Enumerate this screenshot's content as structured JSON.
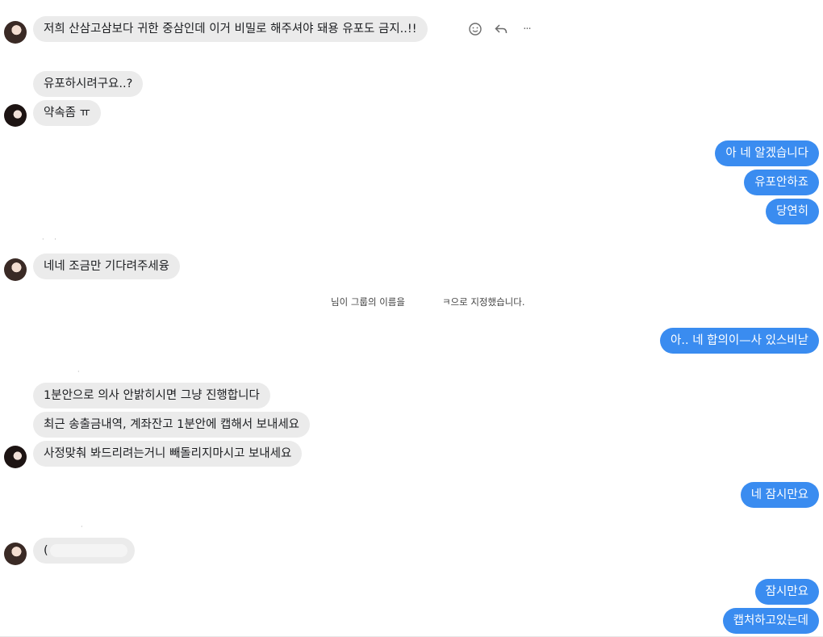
{
  "messages": {
    "m1": "저희 산삼고삼보다 귀한 중삼인데 이거 비밀로 해주셔야 돼용 유포도 금지..!!",
    "m2": "유포하시려구요..?",
    "m3": "약속좀 ㅠ",
    "m4": "아 네 알겠습니다",
    "m5": "유포안하죠",
    "m6": "당연히",
    "m7": "네네 조금만 기다려주세융",
    "m8": "아.. 네 합의이—사 있스비낟",
    "m9": "1분안으로 의사 안밝히시면 그냥 진행합니다",
    "m10": "최근 송출금내역, 계좌잔고 1분안에 캡해서 보내세요",
    "m11": "사정맞춰 봐드리려는거니 빼돌리지마시고 보내세요",
    "m12": "네 잠시만요",
    "m13": "(",
    "m14": "잠시만요",
    "m15": "캡처하고있는데"
  },
  "system": {
    "part1": "님이 그룹의 이름을",
    "part2": "ㅋ으로 지정했습니다."
  },
  "actions": {
    "react_icon": "smiley-icon",
    "reply_icon": "reply-icon",
    "more_icon": "more-icon",
    "more_glyph": "···"
  },
  "colors": {
    "outgoing": "#3a8cf0",
    "incoming": "#ebebeb"
  }
}
